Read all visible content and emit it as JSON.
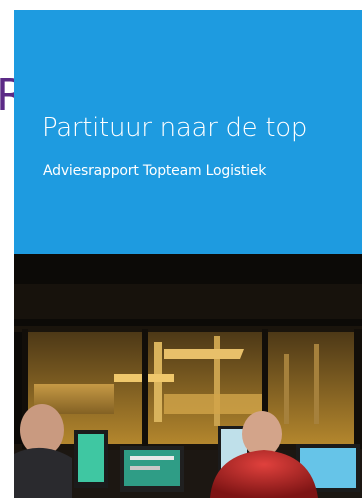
{
  "cover": {
    "left_letter": "R",
    "title": "Partituur naar de top",
    "subtitle": "Adviesrapport Topteam Logistiek"
  },
  "colors": {
    "panel_blue": "#1e9be0",
    "letter_purple": "#5b2a86",
    "text_white": "#ffffff"
  },
  "photo": {
    "description_icon": "control-room-photo"
  }
}
